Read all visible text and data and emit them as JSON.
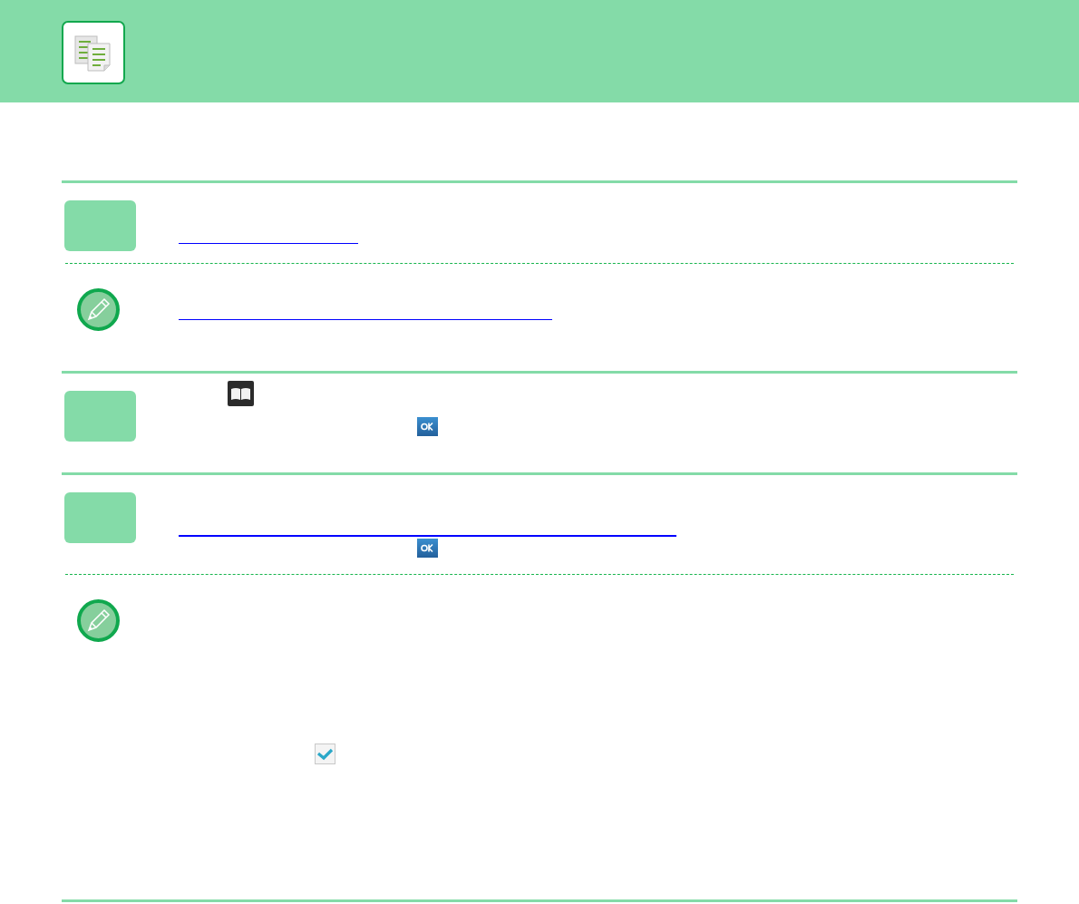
{
  "sections": [
    {
      "kind": "step",
      "items": [
        {
          "kind": "link"
        }
      ]
    },
    {
      "kind": "note",
      "items": [
        {
          "kind": "link"
        }
      ]
    },
    {
      "kind": "step",
      "items": [
        {
          "kind": "book"
        },
        {
          "kind": "ok"
        }
      ]
    },
    {
      "kind": "step",
      "items": [
        {
          "kind": "link"
        },
        {
          "kind": "ok"
        }
      ]
    },
    {
      "kind": "note",
      "items": [
        {
          "kind": "check"
        }
      ]
    }
  ]
}
